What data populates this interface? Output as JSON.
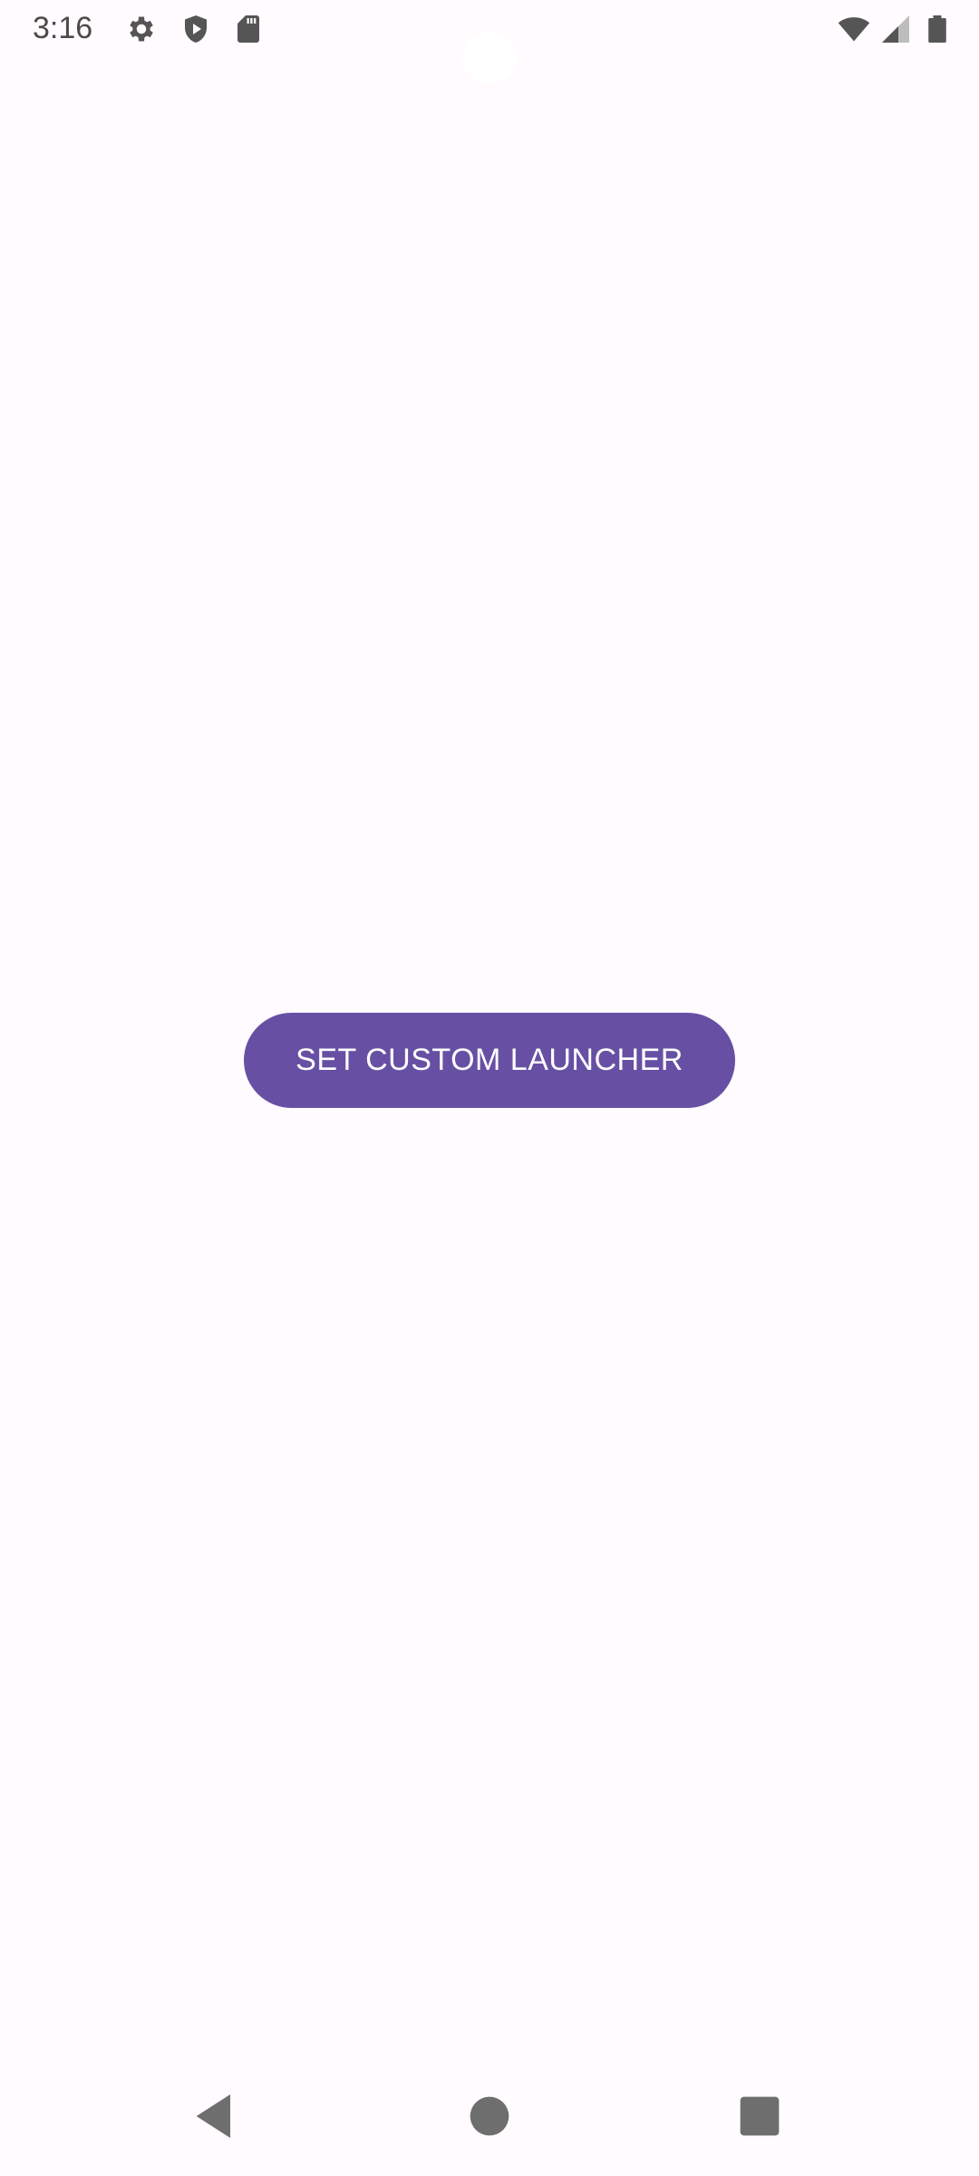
{
  "status_bar": {
    "time": "3:16",
    "left_icons": [
      "gear-icon",
      "shield-play-icon",
      "sd-card-icon"
    ],
    "right_icons": [
      "wifi-icon",
      "cellular-signal-icon",
      "battery-icon"
    ]
  },
  "main": {
    "button_label": "SET CUSTOM LAUNCHER",
    "button_color": "#6750A4",
    "background_color": "#FFFBFE"
  },
  "navigation_bar": {
    "items": [
      "back-icon",
      "home-icon",
      "recents-icon"
    ]
  }
}
